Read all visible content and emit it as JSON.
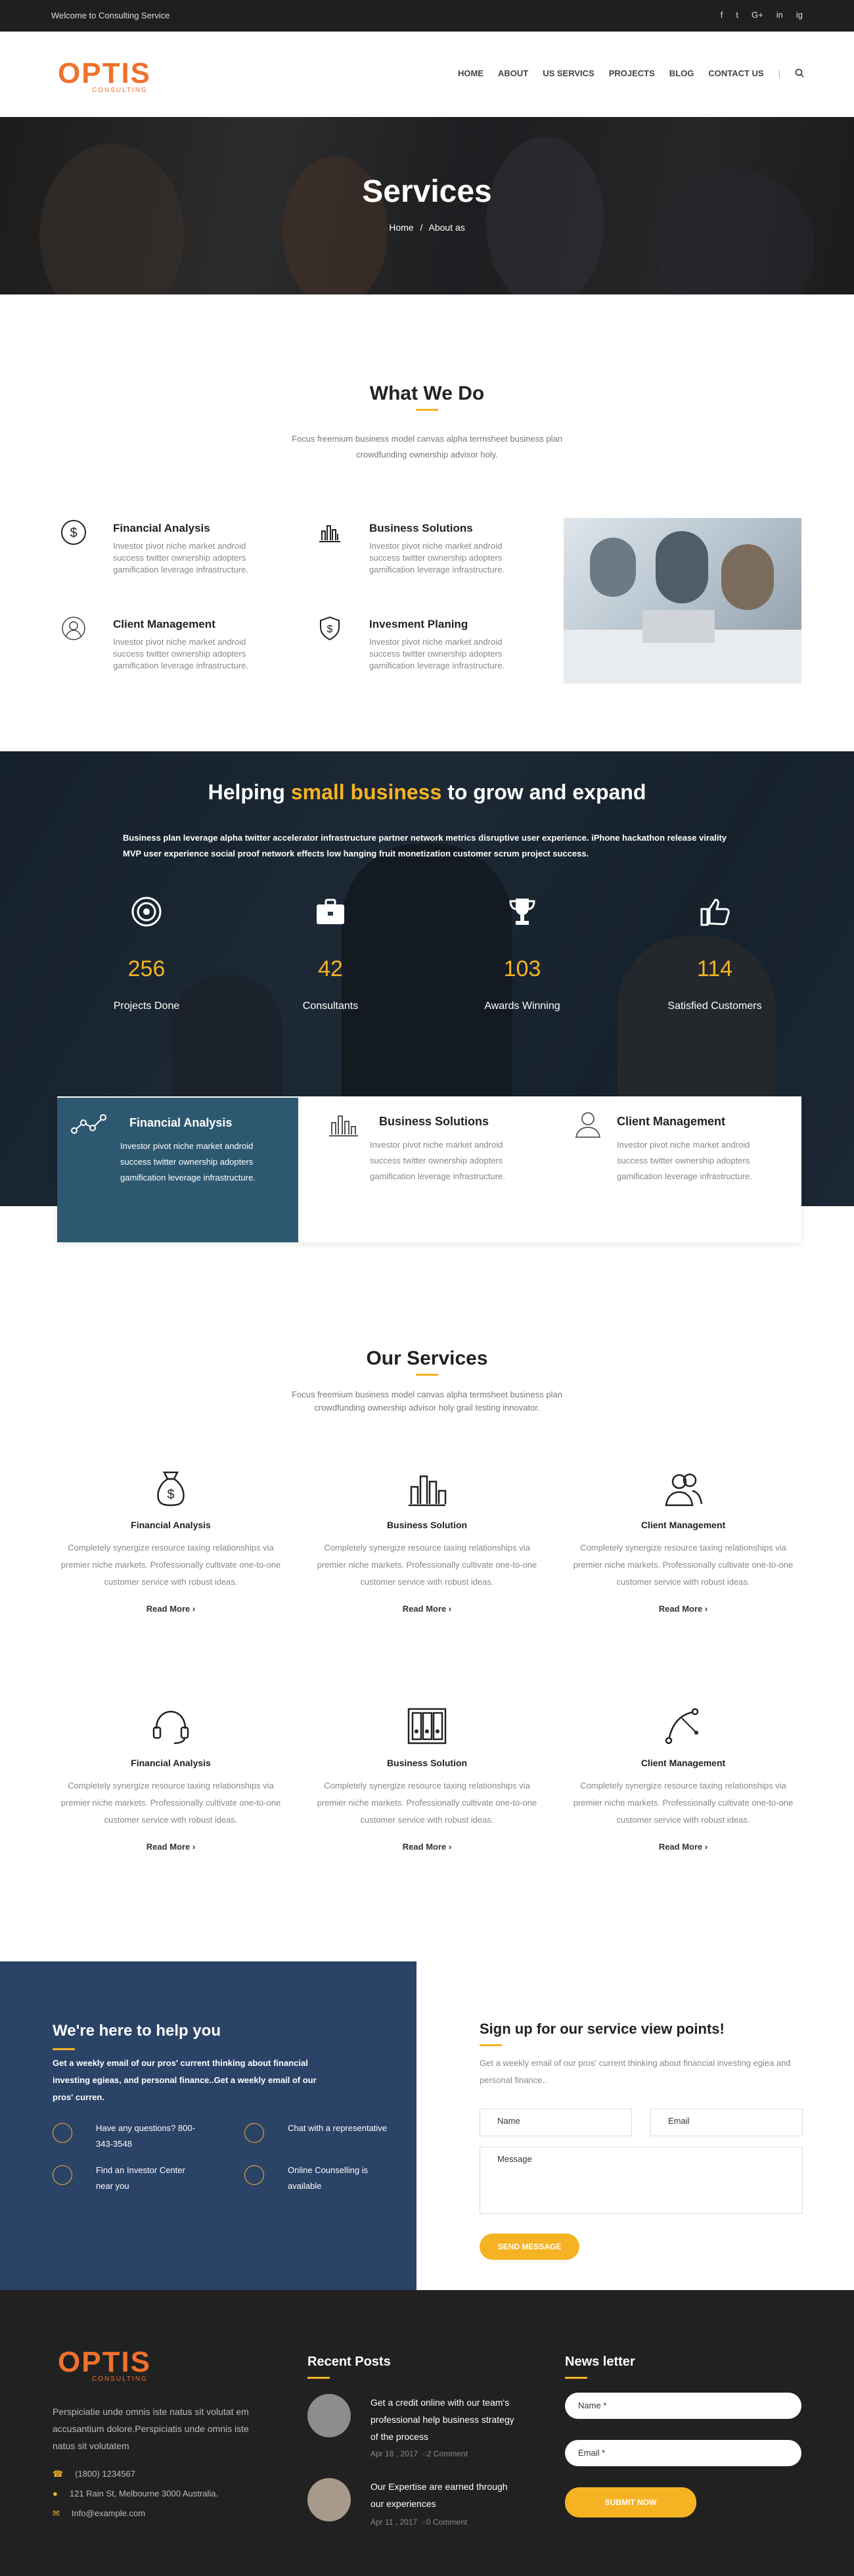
{
  "topbar": {
    "welcome": "Welcome to Consulting Service",
    "social": [
      "f",
      "t",
      "G+",
      "in",
      "ig"
    ]
  },
  "logo": {
    "word": "OPTIS",
    "sub": "CONSULTING"
  },
  "nav": [
    "HOME",
    "ABOUT",
    "US SERVICS",
    "PROJECTS",
    "BLOG",
    "CONTACT US"
  ],
  "hero": {
    "title": "Services",
    "crumb_home": "Home",
    "crumb_sep": "/",
    "crumb_current": "About as"
  },
  "whatwedo": {
    "title": "What We Do",
    "lead": "Focus freemium business model canvas alpha termsheet business plan crowdfunding ownership advisor holy.",
    "items": [
      {
        "title": "Financial Analysis",
        "text": "Investor pivot niche market android success twitter ownership adopters gamification leverage infrastructure.",
        "icon": "dollar-icon"
      },
      {
        "title": "Business Solutions",
        "text": "Investor pivot niche market android success twitter ownership adopters gamification leverage infrastructure.",
        "icon": "bar-chart-icon"
      },
      {
        "title": "Client Management",
        "text": "Investor pivot niche market android success twitter ownership adopters gamification leverage infrastructure.",
        "icon": "user-icon"
      },
      {
        "title": "Invesment Planing",
        "text": "Investor pivot niche market android success twitter ownership adopters gamification leverage infrastructure.",
        "icon": "shield-dollar-icon"
      }
    ]
  },
  "stats": {
    "title_before": "Helping ",
    "title_highlight": "small business",
    "title_after": " to grow and expand",
    "para": "Business plan leverage alpha twitter accelerator infrastructure partner network metrics disruptive user experience. iPhone hackathon release virality MVP user experience social proof network effects low hanging fruit monetization customer scrum project success.",
    "items": [
      {
        "value": "256",
        "label": "Projects Done",
        "icon": "target-icon"
      },
      {
        "value": "42",
        "label": "Consultants",
        "icon": "briefcase-icon"
      },
      {
        "value": "103",
        "label": "Awards Winning",
        "icon": "trophy-icon"
      },
      {
        "value": "114",
        "label": "Satisfied Customers",
        "icon": "thumbs-up-icon"
      }
    ]
  },
  "cards": [
    {
      "title": "Financial Analysis",
      "text": "Investor pivot niche market android success twitter ownership adopters gamification leverage infrastructure.",
      "icon": "graph-icon"
    },
    {
      "title": "Business Solutions",
      "text": "Investor pivot niche market android success twitter ownership adopters gamification leverage infrastructure.",
      "icon": "bar-chart-icon"
    },
    {
      "title": "Client Management",
      "text": "Investor pivot niche market android success twitter ownership adopters gamification leverage infrastructure.",
      "icon": "user-icon"
    }
  ],
  "services": {
    "title": "Our Services",
    "lead": "Focus freemium business model canvas alpha termsheet business plan crowdfunding ownership advisor holy grail testing innovator.",
    "items": [
      {
        "title": "Financial Analysis",
        "text": "Completely synergize resource taxing relationships via premier niche markets. Professionally cultivate one-to-one customer service with robust ideas.",
        "more": "Read More ›",
        "icon": "money-bag-icon"
      },
      {
        "title": "Business Solution",
        "text": "Completely synergize resource taxing relationships via premier niche markets. Professionally cultivate one-to-one customer service with robust ideas.",
        "more": "Read More ›",
        "icon": "bar-chart-icon"
      },
      {
        "title": "Client Management",
        "text": "Completely synergize resource taxing relationships via premier niche markets. Professionally cultivate one-to-one customer service with robust ideas.",
        "more": "Read More ›",
        "icon": "users-icon"
      },
      {
        "title": "Financial Analysis",
        "text": "Completely synergize resource taxing relationships via premier niche markets. Professionally cultivate one-to-one customer service with robust ideas.",
        "more": "Read More ›",
        "icon": "headset-icon"
      },
      {
        "title": "Business Solution",
        "text": "Completely synergize resource taxing relationships via premier niche markets. Professionally cultivate one-to-one customer service with robust ideas.",
        "more": "Read More ›",
        "icon": "binders-icon"
      },
      {
        "title": "Client Management",
        "text": "Completely synergize resource taxing relationships via premier niche markets. Professionally cultivate one-to-one customer service with robust ideas.",
        "more": "Read More ›",
        "icon": "curve-icon"
      }
    ]
  },
  "help": {
    "title": "We're here to help you",
    "para": "Get a weekly email of our pros' current thinking about financial investing egieas, and personal finance..Get a weekly email of our pros' curren.",
    "items": [
      {
        "text": "Have any questions? 800-343-3548"
      },
      {
        "text": "Chat with a representative"
      },
      {
        "text": "Find an Investor Center near you"
      },
      {
        "text": "Online Counselling is available"
      }
    ]
  },
  "signup": {
    "title": "Sign up for our service view points!",
    "para": "Get a weekly email of our pros' current thinking about financial investing egiea and personal finance..",
    "name": "Name",
    "email": "Email",
    "message": "Message",
    "submit": "SEND MESSAGE"
  },
  "footer": {
    "about": "Perspiciatie unde omnis iste natus sit volutat em accusantium dolore.Perspiciatis unde omnis iste natus sit volutatem",
    "phone": "(1800) 1234567",
    "address": "121 Rain St, Melbourne 3000 Australia.",
    "email": "Info@example.com",
    "recent_title": "Recent Posts",
    "posts": [
      {
        "title": "Get a credit online with our team's professional help business strategy of the process",
        "date": "Apr 18 , 2017",
        "comments": "2 Comment"
      },
      {
        "title": "Our Expertise are earned through our experiences",
        "date": "Apr 11 , 2017",
        "comments": "0 Comment"
      }
    ],
    "news_title": "News letter",
    "name_ph": "Name *",
    "email_ph": "Email *",
    "submit": "SUBMIT NOW"
  },
  "colors": {
    "accent": "#f5b324",
    "brand": "#f0712d",
    "navy": "#2b4367",
    "teal": "#2e5870",
    "dark": "#212121"
  }
}
